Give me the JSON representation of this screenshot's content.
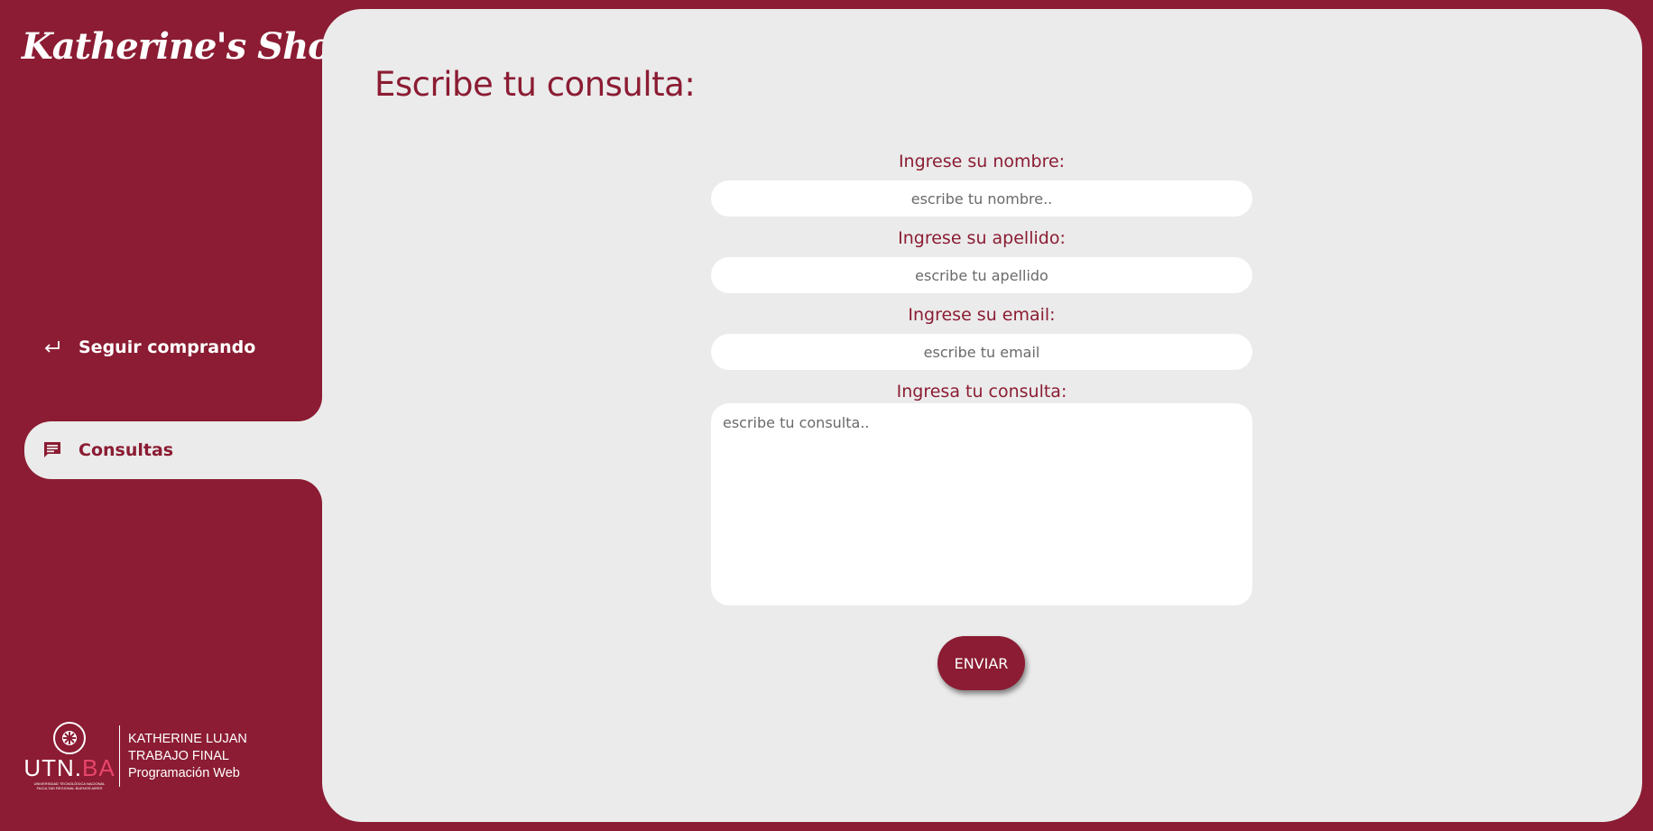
{
  "brand": {
    "logo_text": "Katherine's Shop"
  },
  "sidebar": {
    "items": [
      {
        "label": "Seguir comprando",
        "icon": "return-arrow-icon",
        "active": false
      },
      {
        "label": "Consultas",
        "icon": "chat-message-icon",
        "active": true
      }
    ]
  },
  "footer": {
    "utn_word": "UTN.",
    "utn_ba": "BA",
    "utn_small_line1": "UNIVERSIDAD TECNOLÓGICA NACIONAL",
    "utn_small_line2": "FACULTAD REGIONAL BUENOS AIRES",
    "line1": "KATHERINE LUJAN",
    "line2": "TRABAJO FINAL",
    "line3": "Programación Web"
  },
  "main": {
    "title": "Escribe tu consulta:",
    "form": {
      "nombre_label": "Ingrese su nombre:",
      "nombre_placeholder": "escribe tu nombre..",
      "apellido_label": "Ingrese su apellido:",
      "apellido_placeholder": "escribe tu apellido",
      "email_label": "Ingrese su email:",
      "email_placeholder": "escribe tu email",
      "consulta_label": "Ingresa tu consulta:",
      "consulta_placeholder": "escribe tu consulta..",
      "submit_label": "ENVIAR"
    }
  },
  "colors": {
    "brand": "#8b1c33",
    "panel": "#ebebeb",
    "input_bg": "#ffffff"
  }
}
